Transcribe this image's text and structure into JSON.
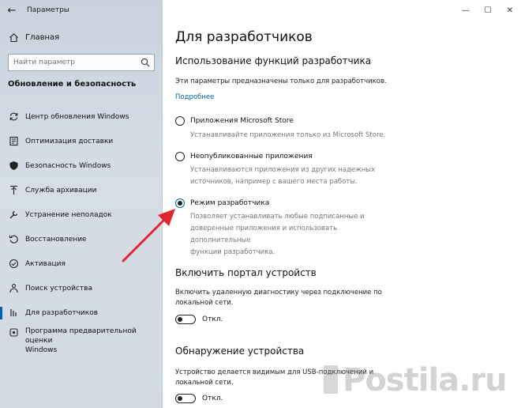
{
  "window": {
    "app_title": "Параметры",
    "controls": {
      "minimize": "—",
      "maximize": "☐",
      "close": "✕"
    }
  },
  "sidebar": {
    "home_label": "Главная",
    "search_placeholder": "Найти параметр",
    "section_heading": "Обновление и безопасность",
    "items": [
      {
        "label": "Центр обновления Windows",
        "icon": "sync-icon"
      },
      {
        "label": "Оптимизация доставки",
        "icon": "delivery-icon"
      },
      {
        "label": "Безопасность Windows",
        "icon": "shield-icon"
      },
      {
        "label": "Служба архивации",
        "icon": "backup-arrow-icon"
      },
      {
        "label": "Устранение неполадок",
        "icon": "wrench-icon"
      },
      {
        "label": "Восстановление",
        "icon": "recovery-icon"
      },
      {
        "label": "Активация",
        "icon": "check-circle-icon"
      },
      {
        "label": "Поиск устройства",
        "icon": "person-pin-icon"
      },
      {
        "label": "Для разработчиков",
        "icon": "developer-icon",
        "active": true
      },
      {
        "label_line1": "Программа предварительной оценки",
        "label_line2": "Windows",
        "icon": "insider-icon"
      }
    ]
  },
  "main": {
    "page_title": "Для разработчиков",
    "subtitle": "Использование функций разработчика",
    "description": "Эти параметры предназначены только для разработчиков.",
    "learn_more_link": "Подробнее",
    "options": [
      {
        "label": "Приложения Microsoft Store",
        "desc_line1": "Устанавливайте приложения только из Microsoft Store.",
        "checked": false
      },
      {
        "label": "Неопубликованные приложения",
        "desc_line1": "Устанавливаются приложения из других надежных",
        "desc_line2": "источников, например с вашего места работы.",
        "checked": false
      },
      {
        "label": "Режим разработчика",
        "desc_line1": "Позволяет устанавливать любые подписанные и",
        "desc_line2": "доверенные приложения и использовать дополнительные",
        "desc_line3": "функции разработчика.",
        "checked": true
      }
    ],
    "device_portal": {
      "heading": "Включить портал устройств",
      "desc_line1": "Включить удаленную диагностику через подключение по",
      "desc_line2": "локальной сети.",
      "toggle_label": "Откл."
    },
    "device_discovery": {
      "heading": "Обнаружение устройства",
      "desc_line1": "Устройство делается видимым для USB-подключений и",
      "desc_line2": "локальной сети.",
      "toggle_label": "Откл."
    }
  },
  "watermark": {
    "text": "Postila.ru"
  },
  "colors": {
    "accent": "#0063b1",
    "arrow": "#e0262e",
    "sidebar_bg": "#d0d8e1"
  }
}
